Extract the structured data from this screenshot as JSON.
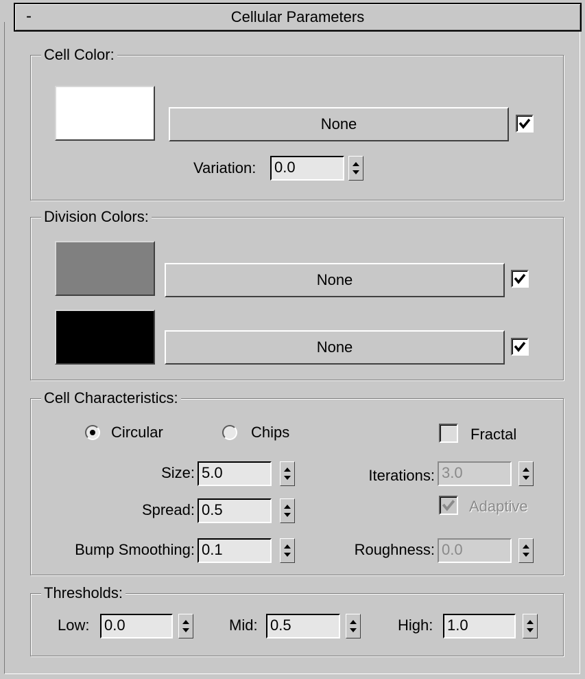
{
  "rollout": {
    "toggle": "-",
    "title": "Cellular Parameters"
  },
  "cell_color": {
    "label": "Cell Color:",
    "swatch_color": "#ffffff",
    "map_button": "None",
    "map_enabled": true,
    "variation_label": "Variation:",
    "variation_value": "0.0"
  },
  "division_colors": {
    "label": "Division Colors:",
    "rows": [
      {
        "swatch_color": "#808080",
        "map_button": "None",
        "map_enabled": true
      },
      {
        "swatch_color": "#000000",
        "map_button": "None",
        "map_enabled": true
      }
    ]
  },
  "cell_characteristics": {
    "label": "Cell Characteristics:",
    "radio_circular": "Circular",
    "radio_chips": "Chips",
    "selected": "Circular",
    "fractal_label": "Fractal",
    "fractal_checked": false,
    "size_label": "Size:",
    "size_value": "5.0",
    "spread_label": "Spread:",
    "spread_value": "0.5",
    "bump_label": "Bump Smoothing:",
    "bump_value": "0.1",
    "iterations_label": "Iterations:",
    "iterations_value": "3.0",
    "adaptive_label": "Adaptive",
    "adaptive_checked": true,
    "roughness_label": "Roughness:",
    "roughness_value": "0.0"
  },
  "thresholds": {
    "label": "Thresholds:",
    "low_label": "Low:",
    "low_value": "0.0",
    "mid_label": "Mid:",
    "mid_value": "0.5",
    "high_label": "High:",
    "high_value": "1.0"
  }
}
